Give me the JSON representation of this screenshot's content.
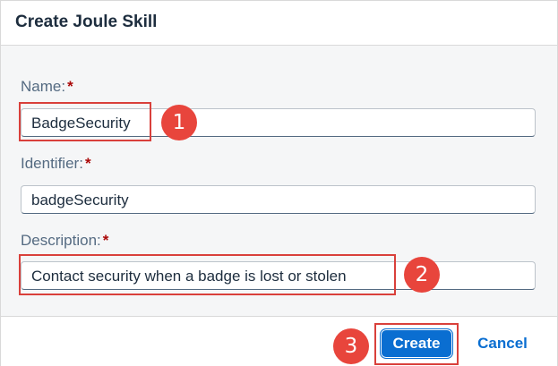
{
  "dialog": {
    "title": "Create Joule Skill"
  },
  "form": {
    "name": {
      "label": "Name:",
      "required": "*",
      "value": "BadgeSecurity"
    },
    "identifier": {
      "label": "Identifier:",
      "required": "*",
      "value": "badgeSecurity"
    },
    "description": {
      "label": "Description:",
      "required": "*",
      "value": "Contact security when a badge is lost or stolen"
    }
  },
  "footer": {
    "create_label": "Create",
    "cancel_label": "Cancel"
  },
  "callouts": [
    "1",
    "2",
    "3"
  ],
  "colors": {
    "accent": "#0a6ed1",
    "callout": "#e8453c",
    "highlight": "#d9403b",
    "required": "#aa0808"
  }
}
